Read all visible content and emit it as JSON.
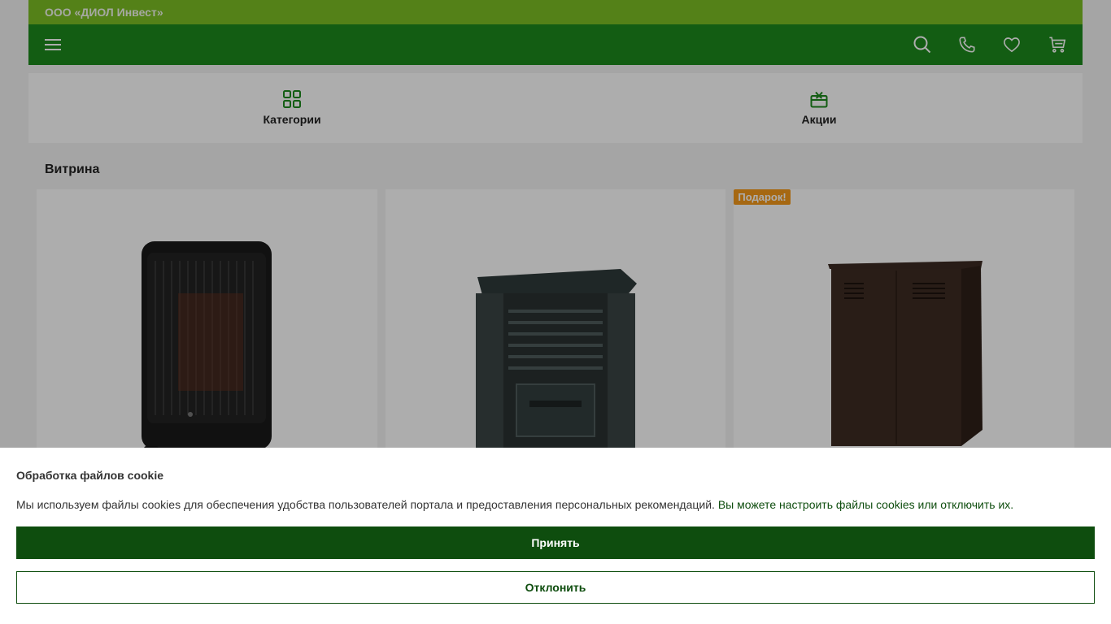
{
  "header": {
    "company": "ООО «ДИОЛ Инвест»",
    "accent_top": "#7cbf24",
    "accent_nav": "#1d8a1d",
    "icons": [
      "menu-icon",
      "search-icon",
      "phone-icon",
      "heart-icon",
      "cart-icon"
    ]
  },
  "quicknav": {
    "items": [
      {
        "label": "Категории",
        "icon": "grid-icon"
      },
      {
        "label": "Акции",
        "icon": "gift-icon"
      }
    ]
  },
  "showcase": {
    "title": "Витрина",
    "products": [
      {
        "image": "gas-heater",
        "badge": ""
      },
      {
        "image": "composter-bin",
        "badge": ""
      },
      {
        "image": "metal-cabinet",
        "badge": "Подарок!"
      }
    ]
  },
  "cookie": {
    "title": "Обработка файлов cookie",
    "text": "Мы используем файлы cookies для обеспечения удобства пользователей портала и предоставления персональных рекомендаций.",
    "link": "Вы можете настроить файлы cookies или отключить их.",
    "accept": "Принять",
    "decline": "Отклонить",
    "accent": "#0e4d0e"
  }
}
